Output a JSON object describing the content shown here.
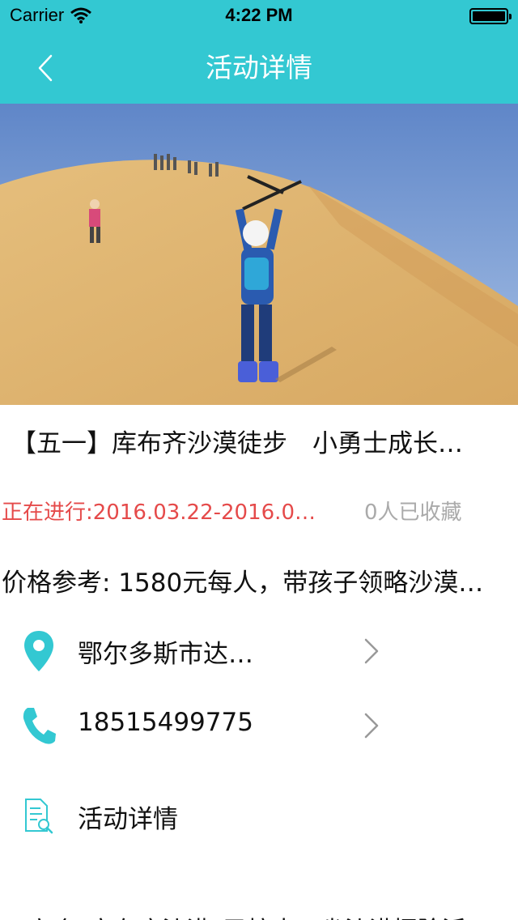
{
  "status_bar": {
    "carrier": "Carrier",
    "time": "4:22 PM"
  },
  "nav": {
    "title": "活动详情"
  },
  "activity": {
    "title": "【五一】库布齐沙漠徒步　小勇士成长…",
    "status": "正在进行:2016.03.22-2016.0…",
    "favorites": "0人已收藏",
    "price": "价格参考: 1580元每人，带孩子领略沙漠…",
    "address": "鄂尔多斯市达…",
    "phone": "18515499775",
    "details_label": "活动详情",
    "description": "▲ 六个“家在库沙漠”已掠中五省沙漠探险活"
  },
  "colors": {
    "accent": "#33c8d2",
    "status_red": "#e54a4a",
    "muted": "#aaaaaa"
  },
  "icons": [
    "wifi-icon",
    "battery-icon",
    "back-chevron-icon",
    "location-pin-icon",
    "phone-icon",
    "document-search-icon",
    "chevron-right-icon"
  ]
}
